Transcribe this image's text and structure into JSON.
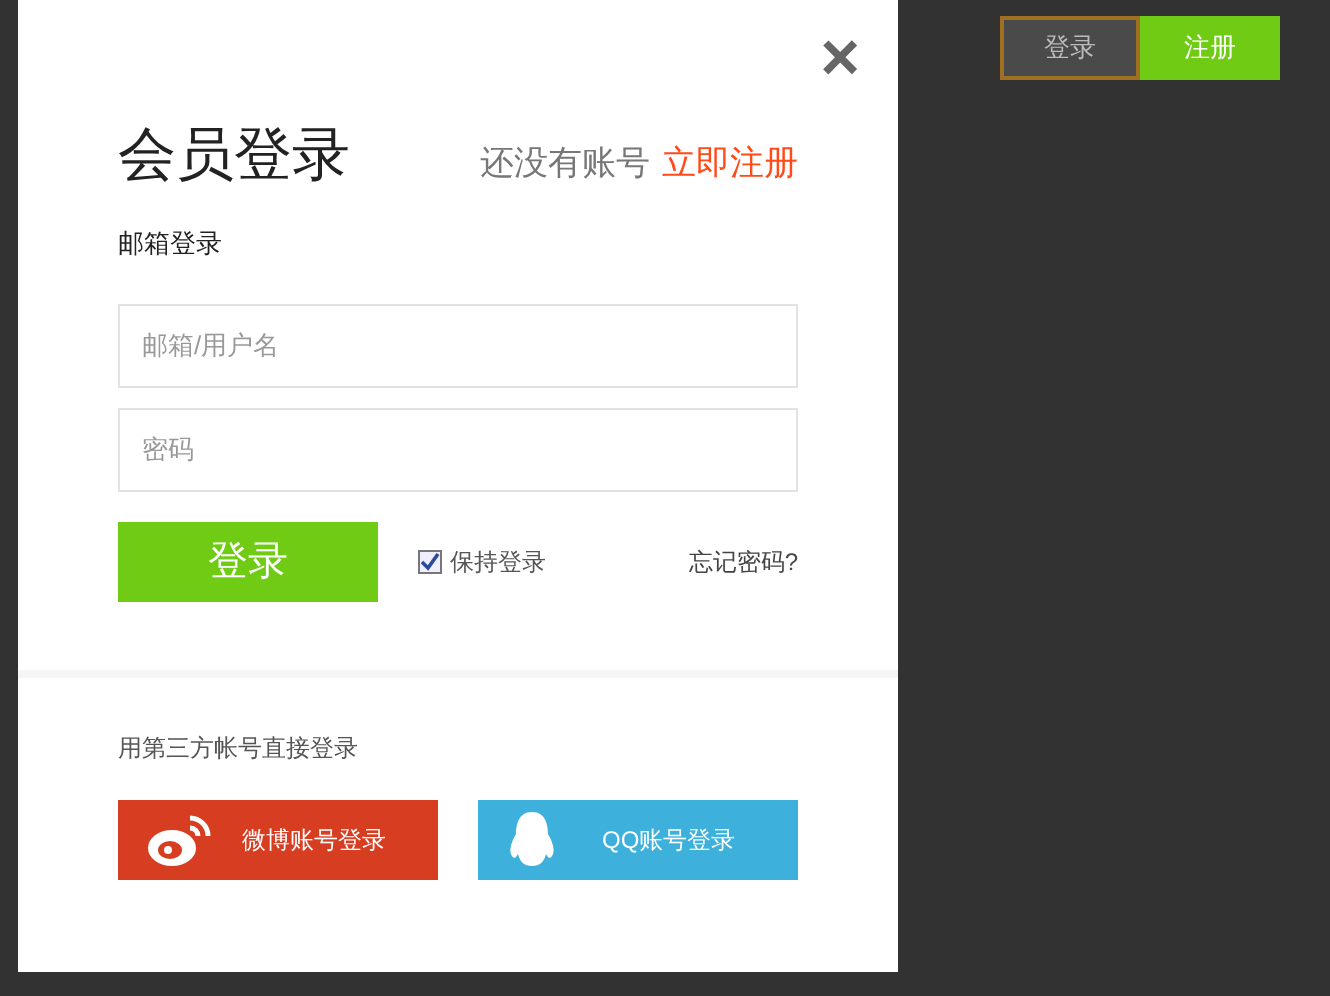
{
  "header": {
    "buttons": [
      {
        "kind": "outline",
        "label": "登录",
        "selected": true
      },
      {
        "kind": "solid",
        "label": "注册",
        "selected": false
      }
    ]
  },
  "dialog": {
    "close": "×",
    "title": "会员登录",
    "register_prompt": "还没有账号",
    "register_link": "立即注册",
    "section_label": "邮箱登录",
    "fields": [
      {
        "placeholder": "邮箱/用户名"
      },
      {
        "placeholder": "密码"
      }
    ],
    "submit": "登录",
    "remember": {
      "label": "保持登录",
      "checked": true
    },
    "forgot": "忘记密码?",
    "third_party_label": "用第三方帐号直接登录",
    "third_party": [
      {
        "kind": "weibo",
        "label": "微博账号登录",
        "color": "#d63d21"
      },
      {
        "kind": "qq",
        "label": "QQ账号登录",
        "color": "#3eb0dc"
      }
    ]
  }
}
